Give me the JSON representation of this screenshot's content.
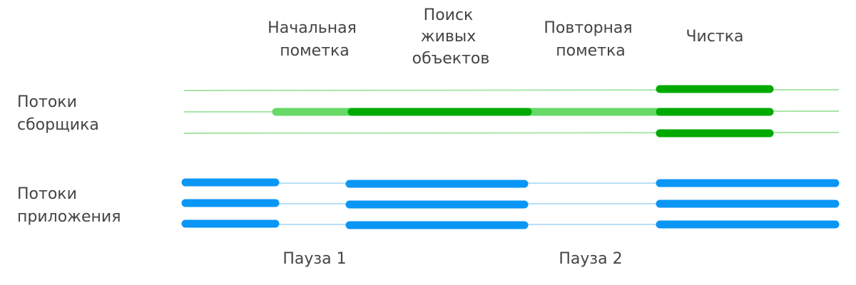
{
  "phases": [
    {
      "lines": [
        "Начальная",
        "пометка"
      ]
    },
    {
      "lines": [
        "Поиск",
        "живых",
        "объектов"
      ]
    },
    {
      "lines": [
        "Повторная",
        "пометка"
      ]
    },
    {
      "lines": [
        "Чистка"
      ]
    }
  ],
  "row_labels": {
    "collector": [
      "Потоки",
      "сборщика"
    ],
    "application": [
      "Потоки",
      "приложения"
    ]
  },
  "pauses": [
    "Пауза 1",
    "Пауза 2"
  ],
  "colors": {
    "collector_thin": "#a8e6a8",
    "collector_light": "#66d966",
    "collector_dark": "#00aa00",
    "app_thin": "#b9def5",
    "app_bar": "#0a96f5",
    "text": "#444444"
  }
}
